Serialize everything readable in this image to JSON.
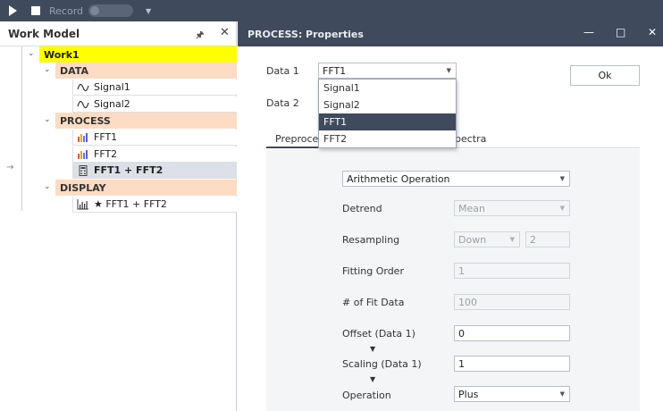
{
  "toolbar": {
    "record_label": "Record"
  },
  "work_model": {
    "title": "Work Model",
    "root": "Work1",
    "categories": [
      {
        "label": "DATA",
        "items": [
          "Signal1",
          "Signal2"
        ]
      },
      {
        "label": "PROCESS",
        "items": [
          "FFT1",
          "FFT2",
          "FFT1 + FFT2"
        ]
      },
      {
        "label": "DISPLAY",
        "items": [
          "★ FFT1 + FFT2"
        ]
      }
    ],
    "selected_item": "FFT1 + FFT2"
  },
  "properties": {
    "title": "PROCESS: Properties",
    "ok_label": "Ok",
    "data1_label": "Data 1",
    "data1_value": "FFT1",
    "data2_label": "Data 2",
    "dropdown_options": [
      "Signal1",
      "Signal2",
      "FFT1",
      "FFT2"
    ],
    "dropdown_highlighted": "FFT1",
    "tabs": [
      "Preproces",
      "pectra"
    ],
    "operation_type": "Arithmetic Operation",
    "fields": {
      "detrend_label": "Detrend",
      "detrend_value": "Mean",
      "resampling_label": "Resampling",
      "resampling_mode": "Down",
      "resampling_factor": "2",
      "fitting_order_label": "Fitting Order",
      "fitting_order_value": "1",
      "fit_data_label": "# of Fit Data",
      "fit_data_value": "100",
      "offset_label": "Offset (Data 1)",
      "offset_value": "0",
      "scaling_label": "Scaling (Data 1)",
      "scaling_value": "1",
      "operation_label": "Operation",
      "operation_value": "Plus"
    }
  },
  "colors": {
    "header_bg": "#3f4a5c",
    "root_highlight": "#ffff00",
    "category_bg": "#fcdcc4",
    "selected_row_bg": "#dde1e7"
  }
}
